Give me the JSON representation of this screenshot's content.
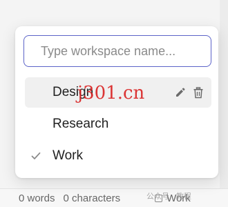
{
  "workspace_switcher": {
    "search": {
      "placeholder": "Type workspace name...",
      "value": ""
    },
    "items": [
      {
        "label": "Design",
        "checked": false,
        "hovered": true
      },
      {
        "label": "Research",
        "checked": false,
        "hovered": false
      },
      {
        "label": "Work",
        "checked": true,
        "hovered": false
      }
    ]
  },
  "status_bar": {
    "words": "0 words",
    "characters": "0 characters",
    "workspace": "Work"
  },
  "overlays": {
    "watermark": "j301.cn",
    "wechat_mark": "公众号 · 教程"
  },
  "colors": {
    "accent_border": "#5b63c8",
    "hover_bg": "#f0f0f0",
    "watermark": "#d92020"
  }
}
